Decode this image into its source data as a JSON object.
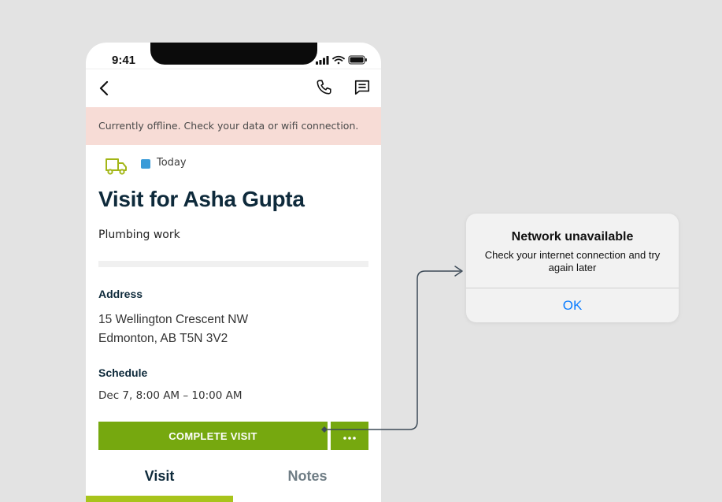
{
  "status_bar": {
    "time": "9:41"
  },
  "offline_banner": "Currently offline. Check your data or wifi connection.",
  "visit": {
    "date_tag": "Today",
    "title": "Visit for Asha Gupta",
    "subtitle": "Plumbing work",
    "address_label": "Address",
    "address_line1": "15 Wellington Crescent NW",
    "address_line2": "Edmonton, AB T5N 3V2",
    "schedule_label": "Schedule",
    "schedule_value": "Dec 7, 8:00 AM – 10:00 AM",
    "complete_button": "COMPLETE VISIT",
    "more_button": "•••"
  },
  "tabs": [
    {
      "label": "Visit",
      "active": true
    },
    {
      "label": "Notes",
      "active": false
    }
  ],
  "dialog": {
    "title": "Network unavailable",
    "message": "Check your internet connection and try again later",
    "ok_label": "OK"
  },
  "colors": {
    "background": "#e3e3e3",
    "primary_green": "#76a80f",
    "tab_underline": "#a8c41c",
    "offline_banner": "#f7dcd6",
    "heading": "#0e2a3b",
    "date_tag": "#3a9bd8",
    "ios_link": "#0a7cff"
  },
  "icons": [
    "back-chevron-icon",
    "phone-icon",
    "message-icon",
    "truck-icon",
    "signal-icon",
    "wifi-icon",
    "battery-icon"
  ]
}
